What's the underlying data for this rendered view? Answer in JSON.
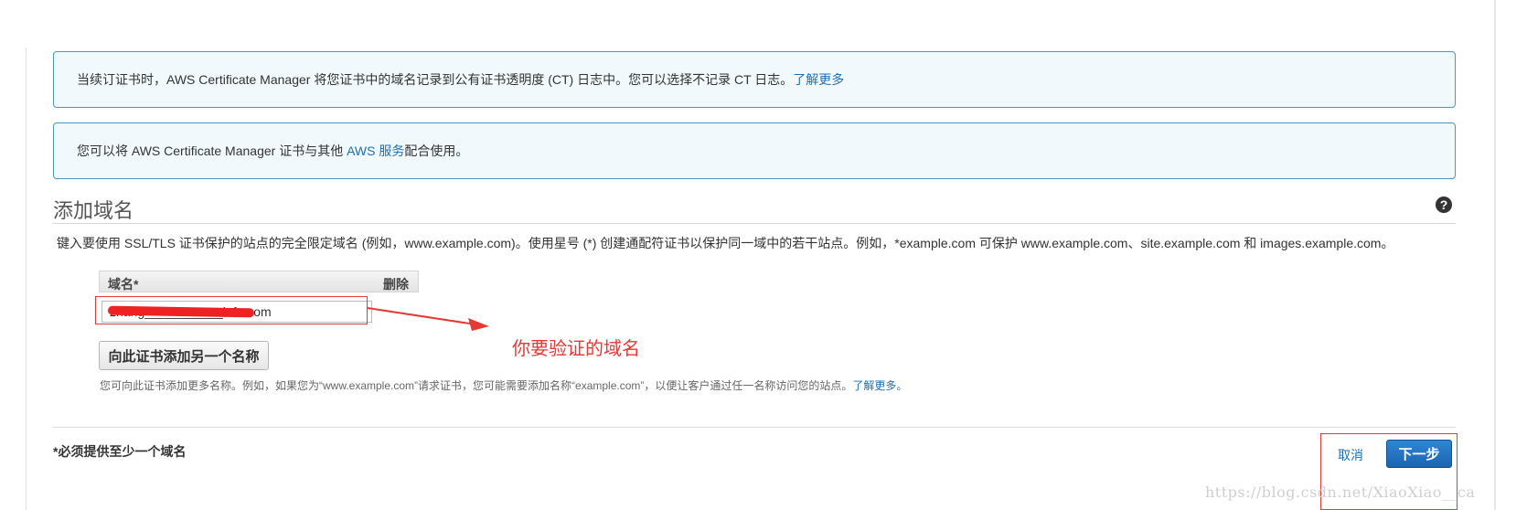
{
  "info_boxes": {
    "ct_text": "当续订证书时，AWS Certificate Manager 将您证书中的域名记录到公有证书透明度 (CT) 日志中。您可以选择不记录 CT 日志。",
    "ct_link": "了解更多",
    "services_text_before": "您可以将 AWS Certificate Manager 证书与其他 ",
    "services_link": "AWS 服务",
    "services_text_after": "配合使用。"
  },
  "section": {
    "title": "添加域名",
    "help_icon": "?",
    "description": "键入要使用 SSL/TLS 证书保护的站点的完全限定域名 (例如，www.example.com)。使用星号 (*) 创建通配符证书以保护同一域中的若干站点。例如，*example.com 可保护 www.example.com、site.example.com 和 images.example.com。"
  },
  "domain_table": {
    "col_domain": "域名*",
    "col_delete": "删除",
    "domain_value": "zhang___________info.com"
  },
  "annotation": {
    "text": "你要验证的域名",
    "color": "#e53935"
  },
  "add_button": {
    "label": "向此证书添加另一个名称"
  },
  "hint": {
    "text": "您可向此证书添加更多名称。例如，如果您为“www.example.com”请求证书，您可能需要添加名称“example.com”，以便让客户通过任一名称访问您的站点。",
    "link": "了解更多。"
  },
  "footer": {
    "required_note": "*必须提供至少一个域名",
    "cancel_label": "取消",
    "next_label": "下一步"
  },
  "watermark": "https://blog.csdn.net/XiaoXiao__ca",
  "colors": {
    "link": "#1f6fb2",
    "info_border": "#4a96c8",
    "info_bg": "#f1f9fc",
    "primary_button": "#1b64b1"
  }
}
